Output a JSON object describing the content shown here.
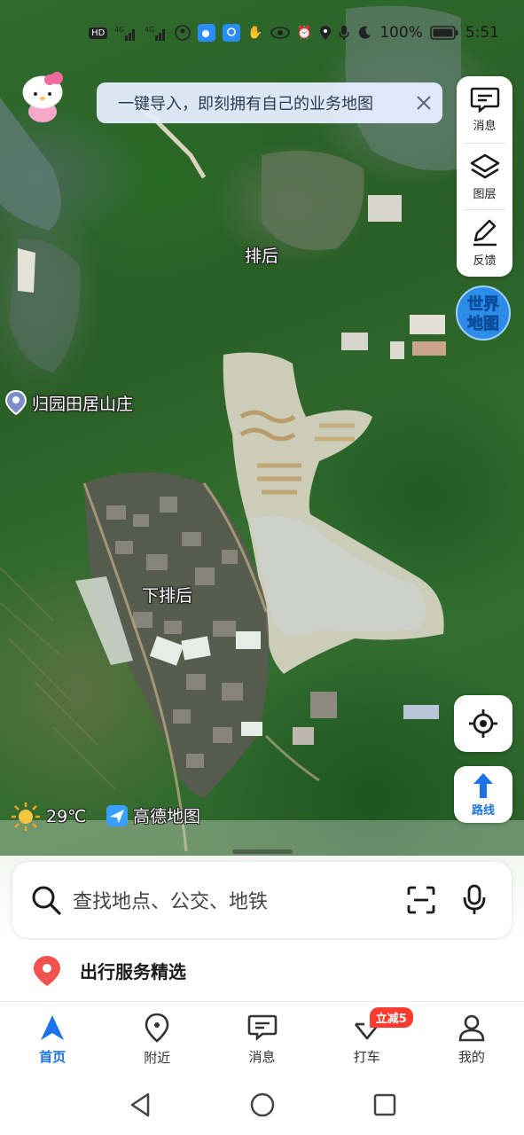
{
  "status_bar": {
    "badges": [
      "HD",
      "4G",
      "4G"
    ],
    "battery": "100%",
    "time": "5:51"
  },
  "banner": {
    "text": "一键导入，即刻拥有自己的业务地图"
  },
  "tool_panel": {
    "items": [
      {
        "label": "消息",
        "icon": "message-icon"
      },
      {
        "label": "图层",
        "icon": "layers-icon"
      },
      {
        "label": "反馈",
        "icon": "feedback-icon"
      }
    ]
  },
  "world_map_badge": {
    "line1": "世界",
    "line2": "地图"
  },
  "map_labels": {
    "paihou": "排后",
    "guiyuan": "归园田居山庄",
    "xiapaihou": "下排后"
  },
  "weather": {
    "temp": "29℃",
    "icon": "sun-icon"
  },
  "brand": {
    "name": "高德地图",
    "icon": "amap-logo-icon"
  },
  "route_button": {
    "label": "路线"
  },
  "search": {
    "placeholder": "查找地点、公交、地铁"
  },
  "service": {
    "title": "出行服务精选"
  },
  "tabs": [
    {
      "label": "首页",
      "active": true
    },
    {
      "label": "附近",
      "active": false
    },
    {
      "label": "消息",
      "active": false
    },
    {
      "label": "打车",
      "active": false,
      "badge": "立减5"
    },
    {
      "label": "我的",
      "active": false
    }
  ],
  "colors": {
    "accent": "#1a73e8",
    "promo": "#ff3b30",
    "pin": "#f0524e"
  }
}
